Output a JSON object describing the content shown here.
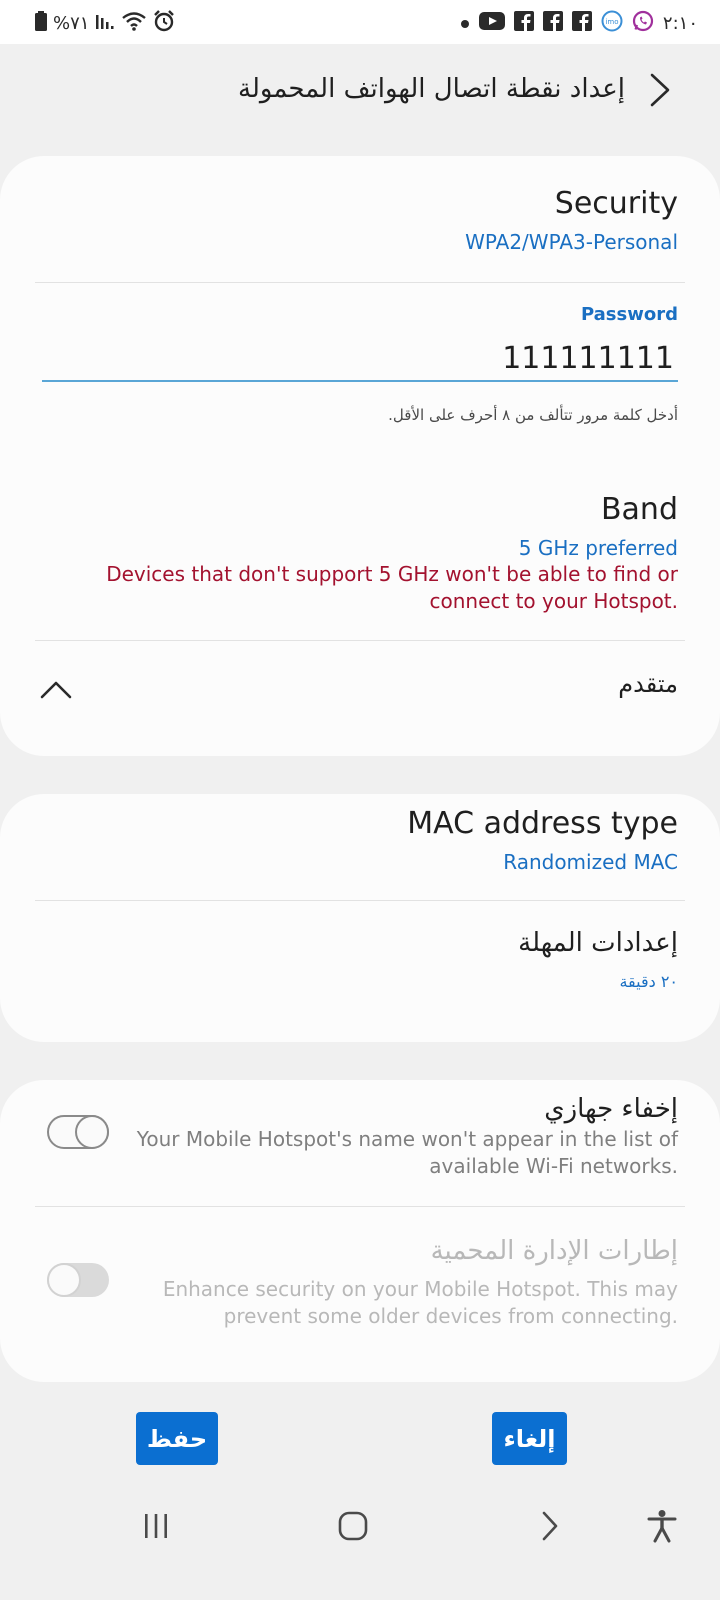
{
  "status_bar": {
    "battery_percent": "%٧١",
    "time": "٢:١٠",
    "left_icons": [
      "battery-icon",
      "signal-icon",
      "wifi-icon",
      "alarm-icon"
    ],
    "right_icons": [
      "dot-icon",
      "youtube-icon",
      "facebook-icon",
      "facebook-icon",
      "facebook-icon",
      "imo-icon",
      "whatsapp-icon"
    ]
  },
  "header": {
    "title": "إعداد نقطة اتصال الهواتف المحمولة",
    "back_icon": "chevron-left-icon"
  },
  "security": {
    "title": "Security",
    "value": "WPA2/WPA3-Personal"
  },
  "password": {
    "label": "Password",
    "value": "111111111",
    "hint": "أدخل كلمة مرور تتألف من ٨ أحرف على الأقل."
  },
  "band": {
    "title": "Band",
    "value": "5 GHz preferred",
    "warning": "Devices that don't support 5 GHz won't be able to find or connect to your Hotspot."
  },
  "advanced": {
    "label": "متقدم",
    "icon": "chevron-up-icon"
  },
  "mac": {
    "title": "MAC address type",
    "value": "Randomized MAC"
  },
  "timeout": {
    "title": "إعدادات المهلة",
    "value": "٢٠ دقيقة"
  },
  "hide_device": {
    "title": "إخفاء جهازي",
    "description": "Your Mobile Hotspot's name won't appear in the list of available Wi-Fi networks.",
    "enabled": false
  },
  "pmf": {
    "title": "إطارات الإدارة المحمية",
    "description": "Enhance security on your Mobile Hotspot. This may prevent some older devices from connecting.",
    "enabled": false,
    "disabled": true
  },
  "buttons": {
    "save": "حفظ",
    "cancel": "إلغاء"
  },
  "colors": {
    "accent": "#1a6fc2",
    "warning": "#a3122f",
    "button": "#0b6fd1"
  }
}
